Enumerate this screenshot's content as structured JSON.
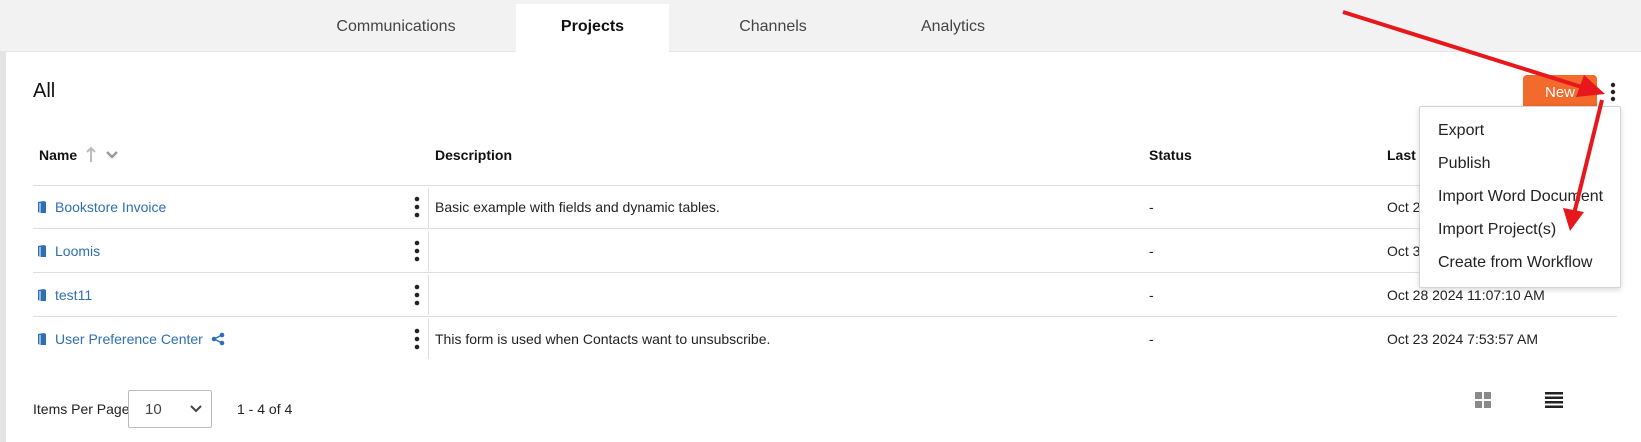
{
  "nav": {
    "tabs": [
      {
        "label": "Communications"
      },
      {
        "label": "Projects"
      },
      {
        "label": "Channels"
      },
      {
        "label": "Analytics"
      }
    ]
  },
  "header": {
    "title": "All",
    "new_label": "New"
  },
  "table": {
    "columns": {
      "name": "Name",
      "description": "Description",
      "status": "Status",
      "last": "Last M"
    },
    "rows": [
      {
        "name": "Bookstore Invoice",
        "description": "Basic example with fields and dynamic tables.",
        "status": "-",
        "date": "Oct 2"
      },
      {
        "name": "Loomis",
        "description": "",
        "status": "-",
        "date": "Oct 3"
      },
      {
        "name": "test11",
        "description": "",
        "status": "-",
        "date": "Oct 28 2024 11:07:10 AM"
      },
      {
        "name": "User Preference Center",
        "description": "This form is used when Contacts want to unsubscribe.",
        "status": "-",
        "date": "Oct 23 2024 7:53:57 AM"
      }
    ]
  },
  "menu": {
    "items": [
      {
        "label": "Export"
      },
      {
        "label": "Publish"
      },
      {
        "label": "Import Word Document"
      },
      {
        "label": "Import Project(s)"
      },
      {
        "label": "Create from Workflow"
      }
    ]
  },
  "pagination": {
    "items_per_page_label": "Items Per Page",
    "per_page_value": "10",
    "range": "1 - 4 of 4"
  },
  "icons": {
    "sort": "sort-ascending-icon",
    "row_book": "book-icon",
    "row_menu": "kebab-icon",
    "share": "share-icon",
    "grid": "grid-view-icon",
    "list": "list-view-icon",
    "chevron": "chevron-down-icon"
  },
  "colors": {
    "accent": "#f26a2c",
    "link": "#2f6fb3",
    "annotation_arrow": "#e8171c"
  }
}
